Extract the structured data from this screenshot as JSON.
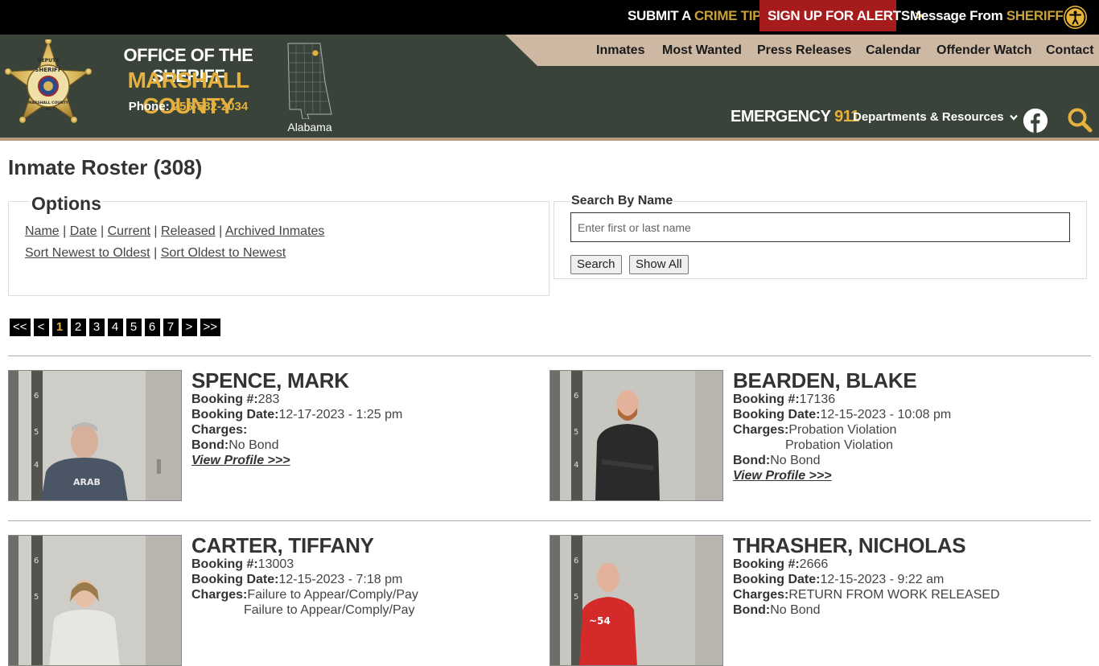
{
  "topbar": {
    "crime_tip_a": "SUBMIT A ",
    "crime_tip_b": "CRIME TIP",
    "alerts": "SIGN UP FOR ALERTS",
    "message_a": "Message From ",
    "message_b": "SHERIFF",
    "chevron": ">"
  },
  "header": {
    "office": "OFFICE OF THE SHERIFF",
    "county": "MARSHALL COUNTY",
    "phone_label": "Phone: ",
    "phone_number": "256-582-2034",
    "state_label": "Alabama",
    "emergency_label": "EMERGENCY ",
    "emergency_number": "911",
    "departments": "Departments & Resources",
    "badge_text_top": "DEPUTY",
    "badge_text_mid": "SHERIFF",
    "badge_text_county": "MARSHALL COUNTY",
    "badge_text_state": "AL"
  },
  "nav": [
    "Inmates",
    "Most Wanted",
    "Press Releases",
    "Calendar",
    "Offender Watch",
    "Contact"
  ],
  "page": {
    "title": "Inmate Roster (308)"
  },
  "options": {
    "legend": "Options",
    "line1": [
      "Name",
      "Date",
      "Current",
      "Released",
      "Archived Inmates"
    ],
    "line2": [
      "Sort Newest to Oldest",
      "Sort Oldest to Newest"
    ],
    "separator": "|"
  },
  "search": {
    "legend": "Search By Name",
    "placeholder": "Enter first or last name",
    "search_button": "Search",
    "show_all_button": "Show All"
  },
  "pager": [
    "<<",
    "<",
    "1",
    "2",
    "3",
    "4",
    "5",
    "6",
    "7",
    ">",
    ">>"
  ],
  "pager_active": "1",
  "labels": {
    "booking_no": "Booking #:",
    "booking_date": "Booking Date:",
    "charges": "Charges:",
    "bond": "Bond:",
    "view_profile": "View Profile >>>"
  },
  "inmates": [
    {
      "name": "SPENCE, MARK",
      "booking_no": "283",
      "booking_date": "12-17-2023 - 1:25 pm",
      "charges": [],
      "bond": "No Bond",
      "shirt": "#4a5566"
    },
    {
      "name": "BEARDEN, BLAKE",
      "booking_no": "17136",
      "booking_date": "12-15-2023 - 10:08 pm",
      "charges": [
        "Probation Violation",
        "Probation Violation"
      ],
      "bond": "No Bond",
      "shirt": "#2a2a2a"
    },
    {
      "name": "CARTER, TIFFANY",
      "booking_no": "13003",
      "booking_date": "12-15-2023 - 7:18 pm",
      "charges": [
        "Failure to Appear/Comply/Pay",
        "Failure to Appear/Comply/Pay"
      ],
      "bond": "",
      "shirt": "#e8e6e0"
    },
    {
      "name": "THRASHER, NICHOLAS",
      "booking_no": "2666",
      "booking_date": "12-15-2023 - 9:22 am",
      "charges": [
        "RETURN FROM WORK RELEASED"
      ],
      "bond": "No Bond",
      "shirt": "#d42a2a"
    }
  ]
}
